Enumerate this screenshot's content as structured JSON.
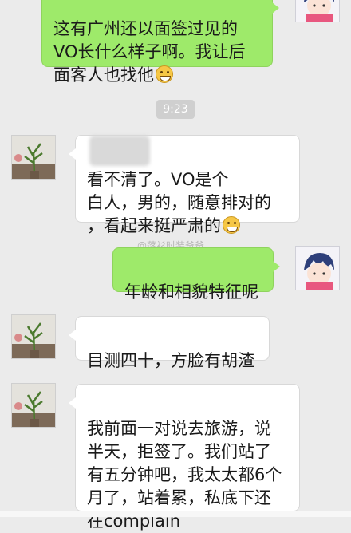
{
  "messages": [
    {
      "side": "right",
      "text": "这有广州还以面签过见的\nVO长什么样子啊。我让后\n面客人也找他",
      "emoji": "grinning-emoji"
    },
    {
      "side": "left",
      "text": "看不清了。VO是个\n白人，男的，随意排对的\n，看起来挺严肃的",
      "emoji": "grinning-emoji"
    },
    {
      "side": "right",
      "text": "年龄和相貌特征呢"
    },
    {
      "side": "left",
      "text": "目测四十，方脸有胡渣"
    },
    {
      "side": "left",
      "text": "我前面一对说去旅游，说\n半天，拒签了。我们站了\n有五分钟吧，我太太都6个\n月了，站着累，私底下还\n在complain"
    }
  ],
  "timestamp": "9:23",
  "watermark": "@落衫时装爸爸",
  "avatars": {
    "self": "cartoon-avatar",
    "other": "plant-avatar"
  }
}
